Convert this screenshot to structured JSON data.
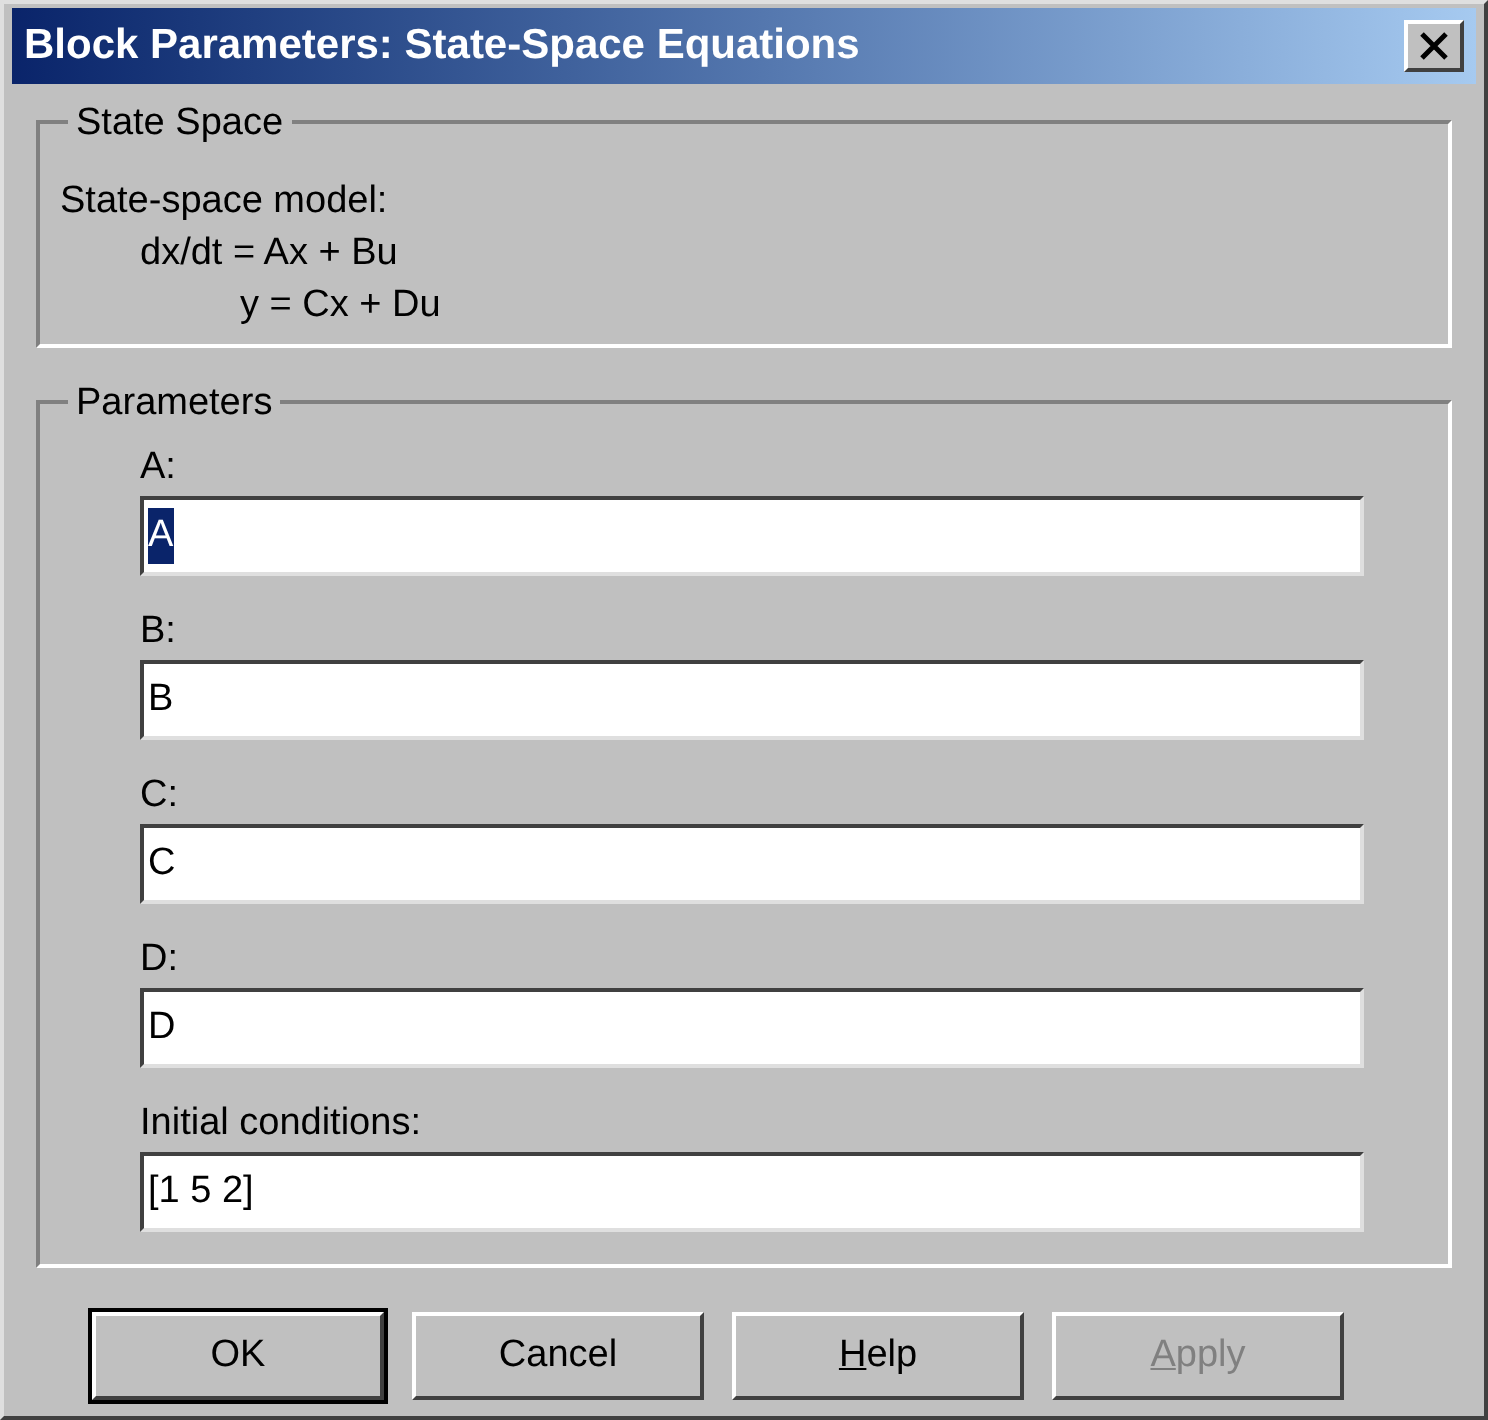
{
  "window": {
    "title": "Block Parameters: State-Space Equations"
  },
  "state_space": {
    "title": "State Space",
    "lines": [
      "State-space model:",
      "dx/dt = Ax + Bu",
      "y = Cx + Du"
    ]
  },
  "parameters": {
    "title": "Parameters",
    "fields": [
      {
        "label": "A:",
        "value": "A",
        "focused": true
      },
      {
        "label": "B:",
        "value": "B",
        "focused": false
      },
      {
        "label": "C:",
        "value": "C",
        "focused": false
      },
      {
        "label": "D:",
        "value": "D",
        "focused": false
      },
      {
        "label": "Initial conditions:",
        "value": "[1 5 2]",
        "focused": false
      }
    ]
  },
  "buttons": [
    {
      "label": "OK",
      "default": true,
      "disabled": false,
      "underline_first": false
    },
    {
      "label": "Cancel",
      "default": false,
      "disabled": false,
      "underline_first": false
    },
    {
      "label": "Help",
      "default": false,
      "disabled": false,
      "underline_first": true
    },
    {
      "label": "Apply",
      "default": false,
      "disabled": true,
      "underline_first": true
    }
  ]
}
